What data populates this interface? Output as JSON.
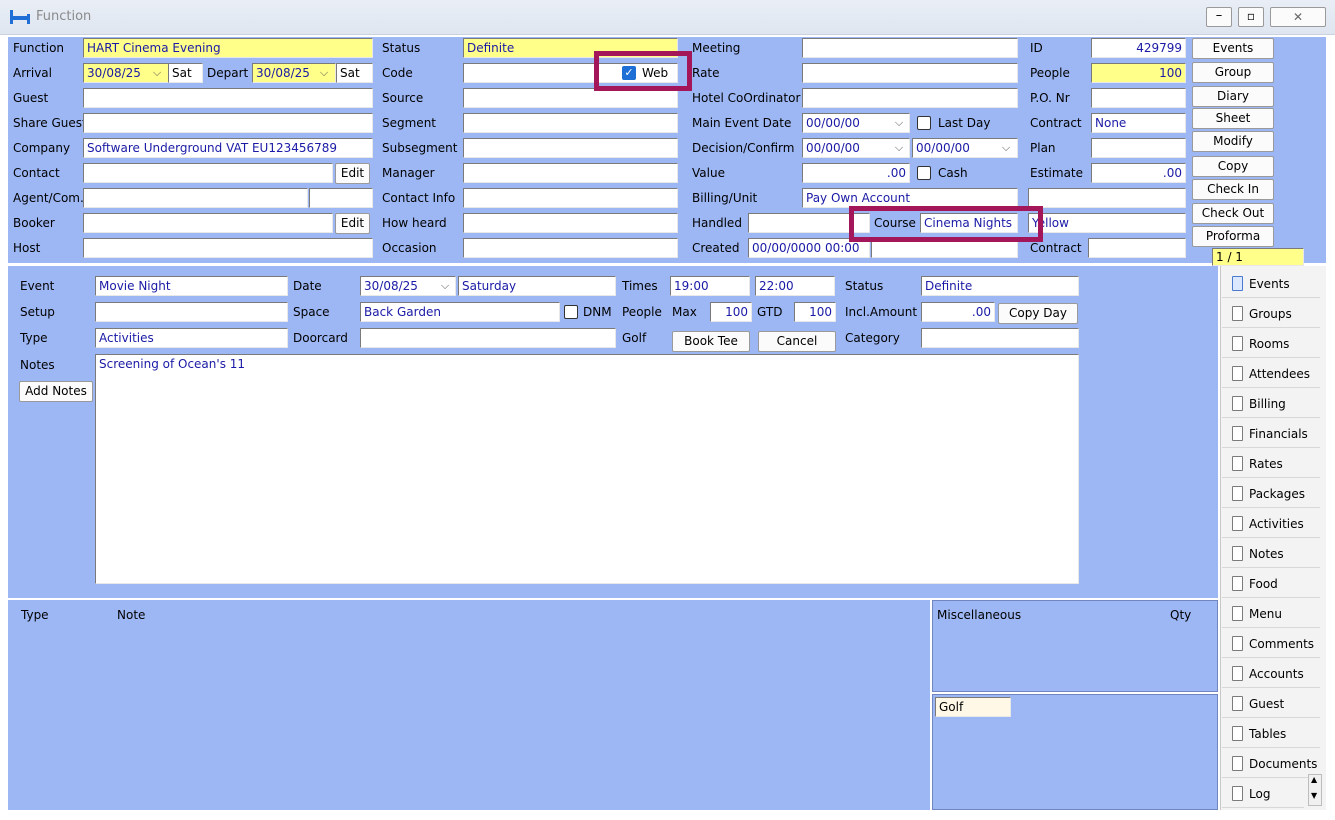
{
  "window": {
    "title": "Function",
    "controls": [
      "–",
      "▫",
      "✕"
    ]
  },
  "header": {
    "function_label": "Function",
    "function_value": "HART Cinema Evening",
    "arrival_label": "Arrival",
    "arrival_date": "30/08/25",
    "arrival_day": "Sat",
    "depart_label": "Depart",
    "depart_date": "30/08/25",
    "depart_day": "Sat",
    "guest_label": "Guest",
    "share_guest_label": "Share Guest",
    "company_label": "Company",
    "company_value": "Software Underground VAT EU123456789",
    "contact_label": "Contact",
    "contact_edit": "Edit",
    "agent_label": "Agent/Com.",
    "booker_label": "Booker",
    "booker_edit": "Edit",
    "host_label": "Host",
    "status_label": "Status",
    "status_value": "Definite",
    "code_label": "Code",
    "web_label": "Web",
    "source_label": "Source",
    "segment_label": "Segment",
    "subsegment_label": "Subsegment",
    "manager_label": "Manager",
    "contact_info_label": "Contact Info",
    "how_heard_label": "How heard",
    "occasion_label": "Occasion",
    "meeting_label": "Meeting",
    "rate_label": "Rate",
    "hotel_coord_label": "Hotel CoOrdinator",
    "main_event_label": "Main Event Date",
    "main_event_value": "00/00/00",
    "last_day_label": "Last Day",
    "decision_label": "Decision/Confirm",
    "decision_value": "00/00/00",
    "confirm_value": "00/00/00",
    "value_label": "Value",
    "value_value": ".00",
    "cash_label": "Cash",
    "billing_label": "Billing/Unit",
    "billing_value": "Pay Own Account",
    "handled_label": "Handled",
    "course_label": "Course",
    "course_value": "Cinema Nights",
    "course_color": "Yellow",
    "created_label": "Created",
    "created_value": "00/00/0000 00:00",
    "id_label": "ID",
    "id_value": "429799",
    "people_label": "People",
    "people_value": "100",
    "po_label": "P.O. Nr",
    "contract_label": "Contract",
    "contract_value": "None",
    "plan_label": "Plan",
    "estimate_label": "Estimate",
    "estimate_value": ".00",
    "contract2_label": "Contract"
  },
  "action_buttons": [
    "Events",
    "Group",
    "Diary",
    "Sheet",
    "Modify",
    "Copy",
    "Check In",
    "Check Out",
    "Proforma"
  ],
  "pager": "1 / 1",
  "event": {
    "event_label": "Event",
    "event_value": "Movie Night",
    "date_label": "Date",
    "date_value": "30/08/25",
    "day_value": "Saturday",
    "times_label": "Times",
    "time_from": "19:00",
    "time_to": "22:00",
    "status_label": "Status",
    "status_value": "Definite",
    "setup_label": "Setup",
    "space_label": "Space",
    "space_value": "Back Garden",
    "dnm_label": "DNM",
    "people_label": "People",
    "max_label": "Max",
    "max_value": "100",
    "gtd_label": "GTD",
    "gtd_value": "100",
    "incl_label": "Incl.Amount",
    "incl_value": ".00",
    "copy_day": "Copy Day",
    "type_label": "Type",
    "type_value": "Activities",
    "doorcard_label": "Doorcard",
    "golf_label": "Golf",
    "book_tee": "Book Tee",
    "cancel": "Cancel",
    "category_label": "Category",
    "notes_label": "Notes",
    "add_notes": "Add Notes",
    "notes_value": "Screening of Ocean's 11"
  },
  "bottom": {
    "type_header": "Type",
    "note_header": "Note",
    "misc_header": "Miscellaneous",
    "qty_header": "Qty",
    "golf_tab": "Golf"
  },
  "nav": [
    "Events",
    "Groups",
    "Rooms",
    "Attendees",
    "Billing",
    "Financials",
    "Rates",
    "Packages",
    "Activities",
    "Notes",
    "Food",
    "Menu",
    "Comments",
    "Accounts",
    "Guest",
    "Tables",
    "Documents",
    "Log"
  ],
  "colors": {
    "panel": "#9db7f5",
    "highlight": "#a3165a",
    "field_yellow": "#ffff8a"
  }
}
